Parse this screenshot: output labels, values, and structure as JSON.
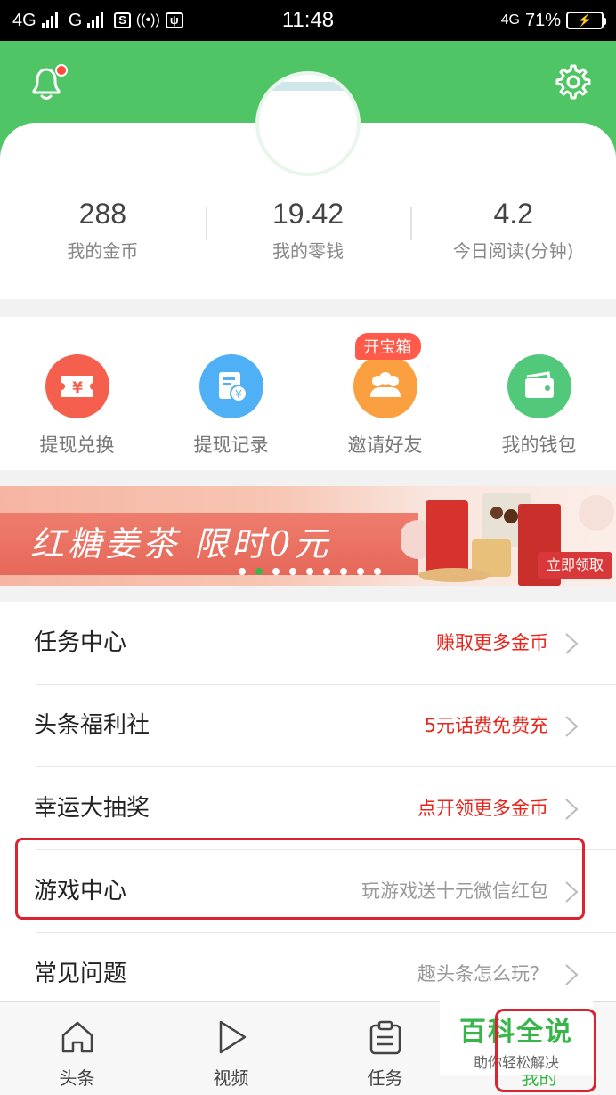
{
  "status_bar": {
    "network_1": "4G",
    "network_2": "G",
    "net_badge": "4G",
    "time": "11:48",
    "battery_percent": "71%"
  },
  "header": {
    "bell_icon": "bell-icon",
    "settings_icon": "gear-icon",
    "accent_color": "#4fc566"
  },
  "stats": [
    {
      "value": "288",
      "label": "我的金币"
    },
    {
      "value": "19.42",
      "label": "我的零钱"
    },
    {
      "value": "4.2",
      "label": "今日阅读(分钟)"
    }
  ],
  "actions": [
    {
      "label": "提现兑换",
      "icon": "ticket-yen-icon",
      "color": "#f4604d"
    },
    {
      "label": "提现记录",
      "icon": "receipt-yen-icon",
      "color": "#4fb0f5"
    },
    {
      "label": "邀请好友",
      "icon": "friends-icon",
      "color": "#fba040",
      "badge": "开宝箱"
    },
    {
      "label": "我的钱包",
      "icon": "wallet-icon",
      "color": "#52c97a"
    }
  ],
  "banner": {
    "title": "红糖姜茶  限时0元",
    "cta": "立即领取",
    "slide_count": 9,
    "active_slide": 2
  },
  "menu": [
    {
      "title": "任务中心",
      "hint": "赚取更多金币",
      "hint_style": "red"
    },
    {
      "title": "头条福利社",
      "hint": "5元话费免费充",
      "hint_style": "red"
    },
    {
      "title": "幸运大抽奖",
      "hint": "点开领更多金币",
      "hint_style": "red"
    },
    {
      "title": "游戏中心",
      "hint": "玩游戏送十元微信红包",
      "hint_style": "grey"
    },
    {
      "title": "常见问题",
      "hint": "趣头条怎么玩？",
      "hint_style": "grey"
    }
  ],
  "bottom_nav": [
    {
      "label": "头条",
      "icon": "home-icon"
    },
    {
      "label": "视频",
      "icon": "play-icon"
    },
    {
      "label": "任务",
      "icon": "clipboard-icon"
    },
    {
      "label": "我的",
      "icon": "profile-icon",
      "active": true
    }
  ],
  "watermark": {
    "title": "百科全说",
    "subtitle": "助你轻松解决"
  }
}
